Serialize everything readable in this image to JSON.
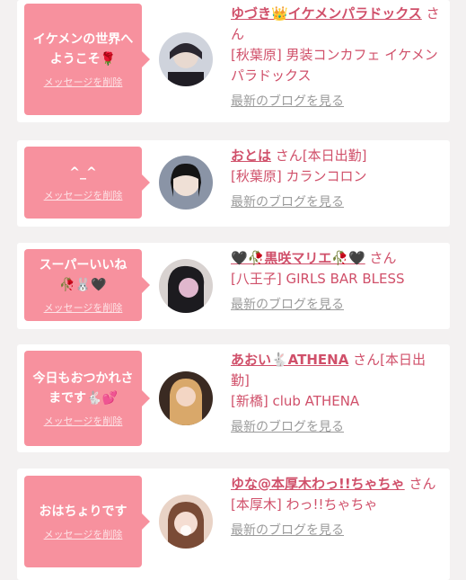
{
  "items": [
    {
      "message": "イケメンの世界へ\nようこそ🌹",
      "delete_label": "メッセージを削除",
      "name": "ゆづき👑イケメンパラドックス",
      "honorific": "さん",
      "status": "",
      "shop": "[秋葉原] 男装コンカフェ イケメンパラドックス",
      "blog_link": "最新のブログを見る",
      "avatar_icon": "avatar-photo"
    },
    {
      "message": "^_^",
      "delete_label": "メッセージを削除",
      "name": "おとは",
      "honorific": "さん",
      "status": "[本日出勤]",
      "shop": "[秋葉原] カランコロン",
      "blog_link": "最新のブログを見る",
      "avatar_icon": "avatar-photo"
    },
    {
      "message": "スーパーいいね\n🥀🐰🖤",
      "delete_label": "メッセージを削除",
      "name": "🖤🥀黒咲マリエ🥀🖤",
      "honorific": "さん",
      "status": "",
      "shop": "[八王子] GIRLS BAR BLESS",
      "blog_link": "最新のブログを見る",
      "avatar_icon": "avatar-photo"
    },
    {
      "message": "今日もおつかれさ\nまです🐇💕",
      "delete_label": "メッセージを削除",
      "name": "あおい🐇ATHENA",
      "honorific": "さん",
      "status": "[本日出勤]",
      "shop": "[新橋] club ATHENA",
      "blog_link": "最新のブログを見る",
      "avatar_icon": "avatar-photo"
    },
    {
      "message": "おはちょりです",
      "delete_label": "メッセージを削除",
      "name": "ゆな@本厚木わっ!!ちゃちゃ",
      "honorific": "さん",
      "status": "",
      "shop": "[本厚木] わっ!!ちゃちゃ",
      "blog_link": "最新のブログを見る",
      "avatar_icon": "avatar-photo"
    }
  ],
  "colors": {
    "bubble": "#f7919e",
    "accent": "#d0506a",
    "link_gray": "#9b9b9b",
    "background": "#f3f1f1"
  }
}
